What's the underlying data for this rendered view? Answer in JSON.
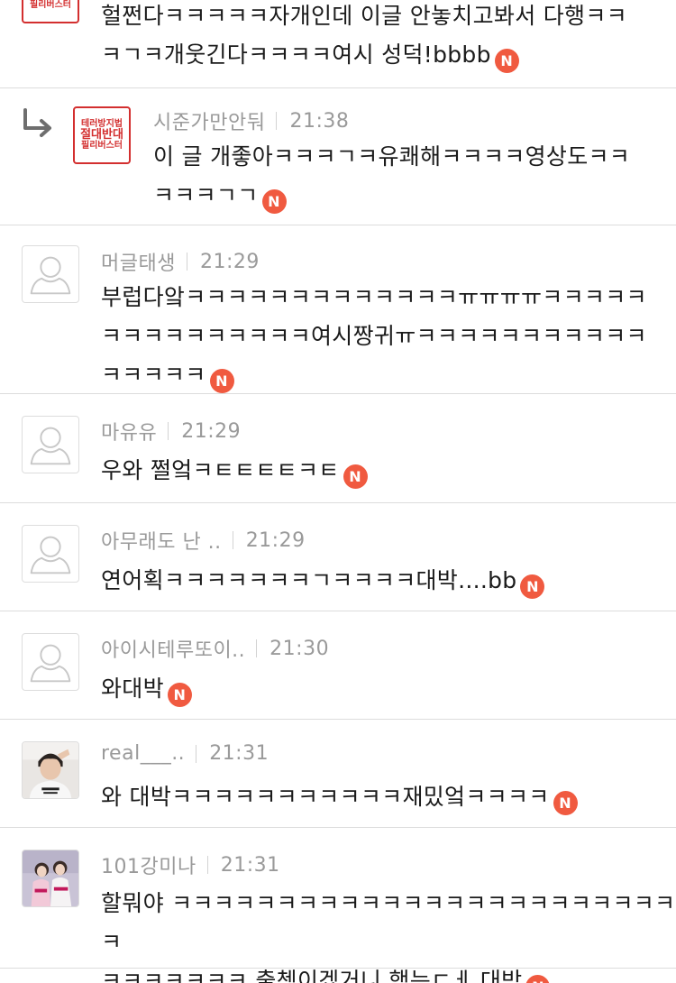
{
  "badge": {
    "label": "N",
    "color": "#f05a40"
  },
  "brand_logo": {
    "line1": "테러방지법",
    "line2": "절대반대",
    "line3": "필리버스터"
  },
  "comments": [
    {
      "author": "",
      "time": "",
      "line1": "헐쩐다ㅋㅋㅋㅋㅋ자개인데 이글 안놓치고봐서 다행ㅋㅋ",
      "line2": "ㅋㄱㅋ개웃긴다ㅋㅋㅋㅋ여시 성덕!bbbb",
      "avatar": "brand-logo"
    },
    {
      "author": "시준가만안둬",
      "time": "21:38",
      "line1": "이 글 개좋아ㅋㅋㅋㄱㅋ유쾌해ㅋㅋㅋㅋ영상도ㅋㅋ",
      "line2": "ㅋㅋㅋㄱㄱ",
      "avatar": "brand-logo",
      "is_reply": true
    },
    {
      "author": "머글태생",
      "time": "21:29",
      "line1": "부럽다앜ㅋㅋㅋㅋㅋㅋㅋㅋㅋㅋㅋㅋㅋㅠㅠㅠㅠㅋㅋㅋㅋㅋ",
      "line2": "ㅋㅋㅋㅋㅋㅋㅋㅋㅋㅋ여시짱귀ㅠㅋㅋㅋㅋㅋㅋㅋㅋㅋㅋㅋ",
      "line3": "ㅋㅋㅋㅋㅋ",
      "avatar": "default-avatar"
    },
    {
      "author": "마유유",
      "time": "21:29",
      "line1": "우와 쩔엌ㅋㅌㅌㅌㅌㅋㅌ",
      "avatar": "default-avatar"
    },
    {
      "author": "아무래도 난 ..",
      "time": "21:29",
      "line1": "연어획ㅋㅋㅋㅋㅋㅋㅋㄱㅋㅋㅋㅋ대박....bb",
      "avatar": "default-avatar"
    },
    {
      "author": "아이시테루또이..",
      "time": "21:30",
      "line1": "와대박",
      "avatar": "default-avatar"
    },
    {
      "author": "real___..",
      "time": "21:31",
      "line1": "와 대박ㅋㅋㅋㅋㅋㅋㅋㅋㅋㅋㅋ재밌엌ㅋㅋㅋㅋ",
      "avatar": "user-photo"
    },
    {
      "author": "101강미나",
      "time": "21:31",
      "line1": "할뭐야 ㅋㅋㅋㅋㅋㅋㅋㅋㅋㅋㅋㅋㅋㅋㅋㅋㅋㅋㅋㅋㅋㅋㅋㅋㅋ",
      "line2": "ㅋㅋㅋㅋㅋㅋㅋ 출첵이겠거니 했는ㄷㅔ 대박",
      "avatar": "user-photo"
    }
  ]
}
